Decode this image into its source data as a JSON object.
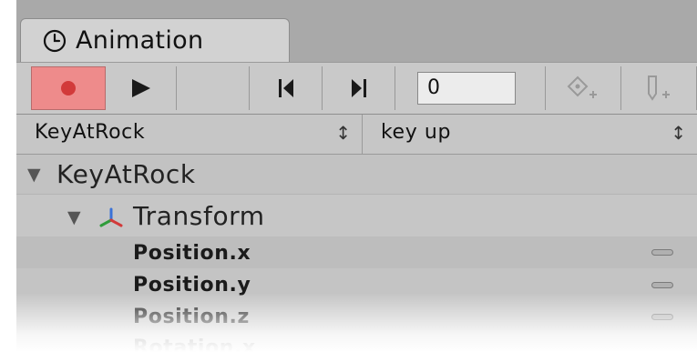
{
  "window": {
    "tab_label": "Animation",
    "tab_icon": "clock-icon"
  },
  "toolbar": {
    "record_icon": "record-icon",
    "record_color": "#d23a3a",
    "play_icon": "play-icon",
    "prev_key_icon": "previous-keyframe-icon",
    "next_key_icon": "next-keyframe-icon",
    "frame_value": "0",
    "add_keyframe_icon": "add-keyframe-icon",
    "add_event_icon": "add-event-icon"
  },
  "selectors": {
    "object_value": "KeyAtRock",
    "clip_value": "key up",
    "arrow_glyph": "↕"
  },
  "hierarchy": {
    "object": "KeyAtRock",
    "component": "Transform",
    "component_icon": "transform-axes-icon",
    "properties": [
      "Position.x",
      "Position.y",
      "Position.z",
      "Rotation.x"
    ]
  }
}
